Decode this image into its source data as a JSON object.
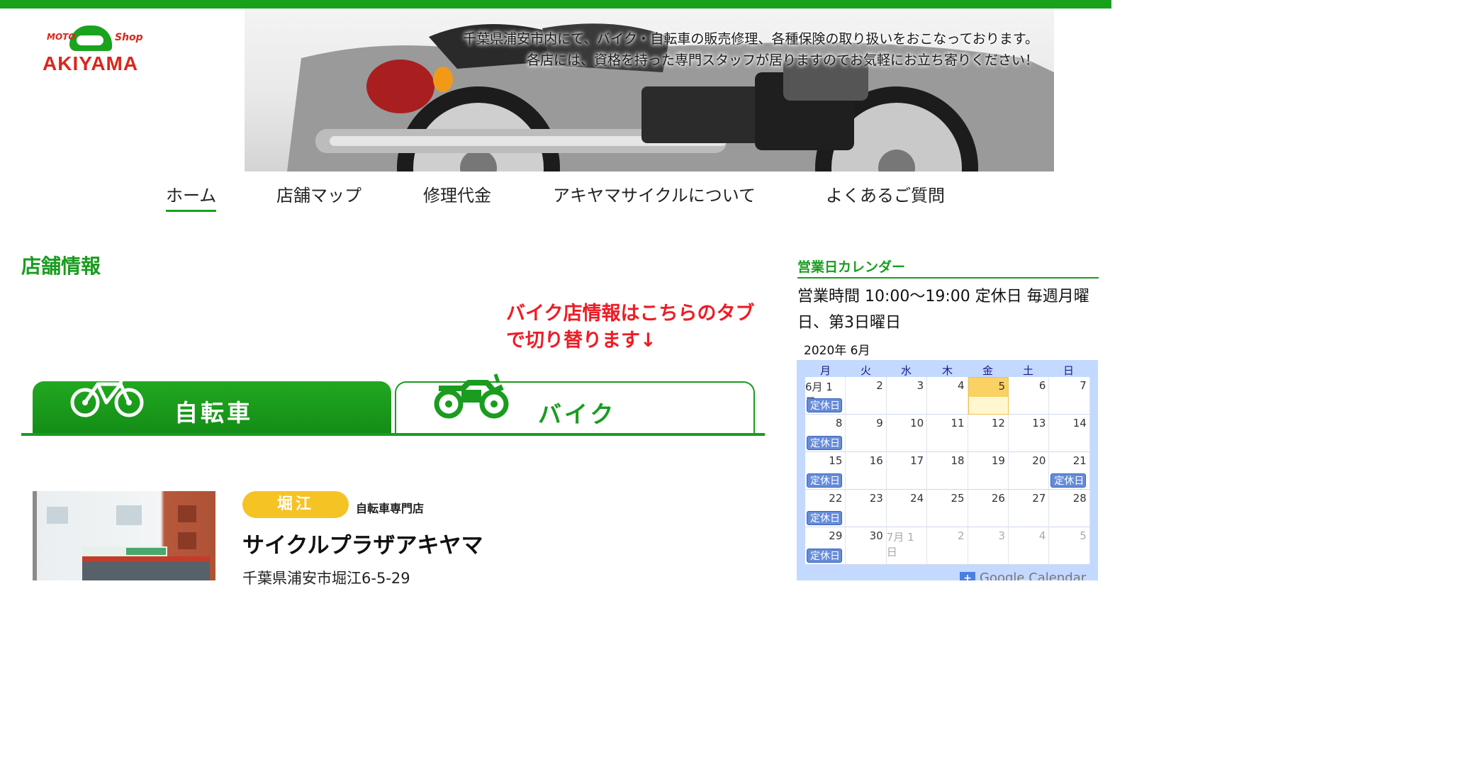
{
  "brand": {
    "logo_moto": "MOTO",
    "logo_shop": "Shop",
    "logo_name": "AKIYAMA",
    "accent": "#18a11c",
    "notice_color": "#ee1c25"
  },
  "hero": {
    "line1": "千葉県浦安市内にて、バイク・自転車の販売修理、各種保険の取り扱いをおこなっております。",
    "line2": "各店には、資格を持った専門スタッフが居りますのでお気軽にお立ち寄りください！"
  },
  "nav": {
    "items": [
      {
        "label": "ホーム",
        "active": true
      },
      {
        "label": "店舗マップ"
      },
      {
        "label": "修理代金"
      },
      {
        "label": "アキヤマサイクルについて"
      },
      {
        "label": "よくあるご質問"
      }
    ]
  },
  "main": {
    "section_title": "店舗情報",
    "notice_line1": "バイク店情報はこちらのタブ",
    "notice_line2": "で切り替ります↓",
    "tabs": [
      {
        "label": "自転車",
        "active": true,
        "icon": "bicycle-icon"
      },
      {
        "label": "バイク",
        "active": false,
        "icon": "motorcycle-icon"
      }
    ],
    "store": {
      "area": "堀江",
      "type": "自転車専門店",
      "name": "サイクルプラザアキヤマ",
      "address": "千葉県浦安市堀江6-5-29"
    }
  },
  "sidebar": {
    "title": "営業日カレンダー",
    "hours": "営業時間 10:00〜19:00 定休日 毎週月曜日、第3日曜日",
    "calendar": {
      "month_label": "2020年 6月",
      "weekdays": [
        "月",
        "火",
        "水",
        "木",
        "金",
        "土",
        "日"
      ],
      "weeks": [
        [
          "6月 1日",
          "2",
          "3",
          "4",
          "5",
          "6",
          "7"
        ],
        [
          "8",
          "9",
          "10",
          "11",
          "12",
          "13",
          "14"
        ],
        [
          "15",
          "16",
          "17",
          "18",
          "19",
          "20",
          "21"
        ],
        [
          "22",
          "23",
          "24",
          "25",
          "26",
          "27",
          "28"
        ],
        [
          "29",
          "30",
          "7月 1日",
          "2",
          "3",
          "4",
          "5"
        ]
      ],
      "event_label": "定休日",
      "footer": "Google Calendar"
    }
  }
}
